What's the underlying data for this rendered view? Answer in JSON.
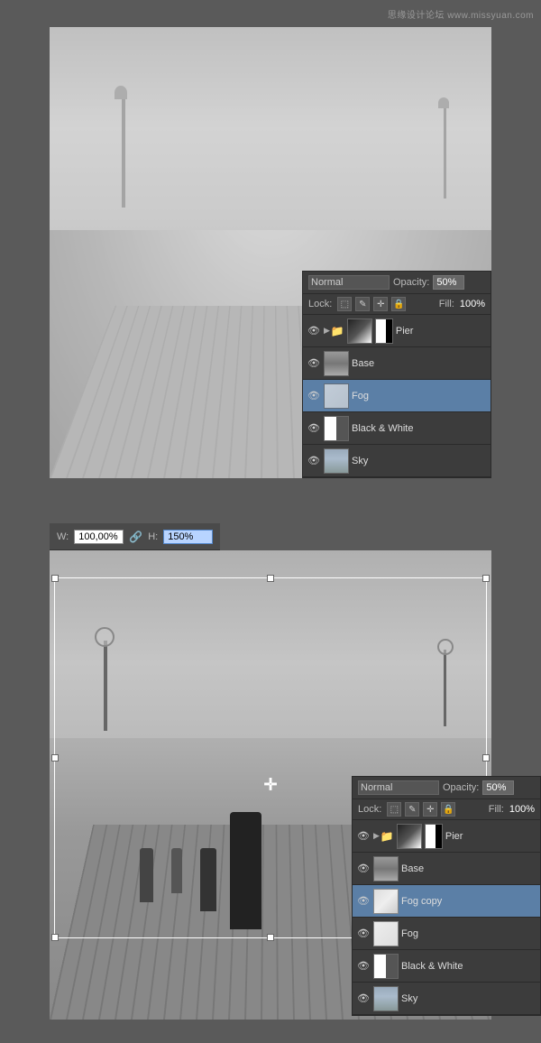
{
  "watermark": {
    "text": "思缘设计论坛  www.missyuan.com"
  },
  "top_panel": {
    "blend_mode": "Normal",
    "opacity_label": "Opacity:",
    "opacity_value": "50%",
    "lock_label": "Lock:",
    "fill_label": "Fill:",
    "fill_value": "100%",
    "layers": [
      {
        "name": "Pier",
        "visible": true,
        "thumb_type": "pier",
        "is_group": true,
        "has_mask": true
      },
      {
        "name": "Base",
        "visible": true,
        "thumb_type": "base",
        "is_group": false,
        "has_mask": false
      },
      {
        "name": "Fog",
        "visible": true,
        "thumb_type": "fog",
        "is_group": false,
        "has_mask": false,
        "active": true
      },
      {
        "name": "Black & White",
        "visible": true,
        "thumb_type": "bw",
        "is_group": false,
        "has_mask": false
      },
      {
        "name": "Sky",
        "visible": true,
        "thumb_type": "sky",
        "is_group": false,
        "has_mask": false
      }
    ]
  },
  "bottom_panel": {
    "transform_w_label": "W:",
    "transform_w_value": "100,00%",
    "transform_h_label": "H:",
    "transform_h_value": "150%",
    "blend_mode": "Normal",
    "opacity_label": "Opacity:",
    "opacity_value": "50%",
    "lock_label": "Lock:",
    "fill_label": "Fill:",
    "fill_value": "100%",
    "layers": [
      {
        "name": "Pier",
        "visible": true,
        "thumb_type": "pier",
        "is_group": true,
        "has_mask": true
      },
      {
        "name": "Base",
        "visible": true,
        "thumb_type": "base",
        "is_group": false,
        "has_mask": false
      },
      {
        "name": "Fog copy",
        "visible": true,
        "thumb_type": "fog-copy",
        "is_group": false,
        "has_mask": false,
        "active": true
      },
      {
        "name": "Fog",
        "visible": true,
        "thumb_type": "fog",
        "is_group": false,
        "has_mask": false
      },
      {
        "name": "Black & White",
        "visible": true,
        "thumb_type": "bw",
        "is_group": false,
        "has_mask": false
      },
      {
        "name": "Sky",
        "visible": true,
        "thumb_type": "sky",
        "is_group": false,
        "has_mask": false
      }
    ]
  },
  "icons": {
    "eye": "👁",
    "chain": "🔗",
    "folder": "📁",
    "lock_transparent": "⬜",
    "lock_image": "🖼",
    "lock_move": "✛",
    "lock_all": "🔒",
    "arrow_right": "▶",
    "crosshair": "✛"
  }
}
